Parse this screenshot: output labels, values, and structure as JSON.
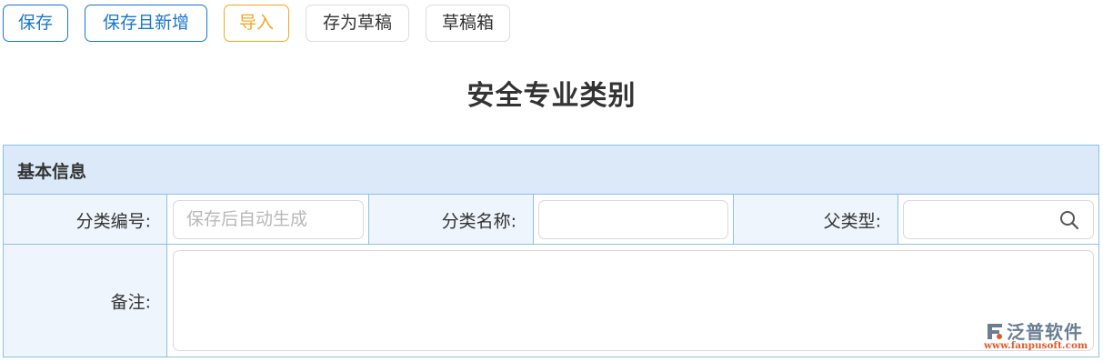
{
  "toolbar": {
    "save_label": "保存",
    "save_new_label": "保存且新增",
    "import_label": "导入",
    "save_draft_label": "存为草稿",
    "draft_box_label": "草稿箱"
  },
  "page": {
    "title": "安全专业类别"
  },
  "form": {
    "section_title": "基本信息",
    "code_label": "分类编号:",
    "code_placeholder": "保存后自动生成",
    "name_label": "分类名称:",
    "name_value": "",
    "parent_label": "父类型:",
    "parent_value": "",
    "remark_label": "备注:",
    "remark_value": ""
  },
  "watermark": {
    "name": "泛普软件",
    "url": "www.fanpusoft.com"
  },
  "colors": {
    "accent": "#1976d2",
    "import_button": "#f5a623",
    "border": "#8cc1e3",
    "header_bg": "#dbe9f8",
    "label_bg": "#eef5fc"
  }
}
